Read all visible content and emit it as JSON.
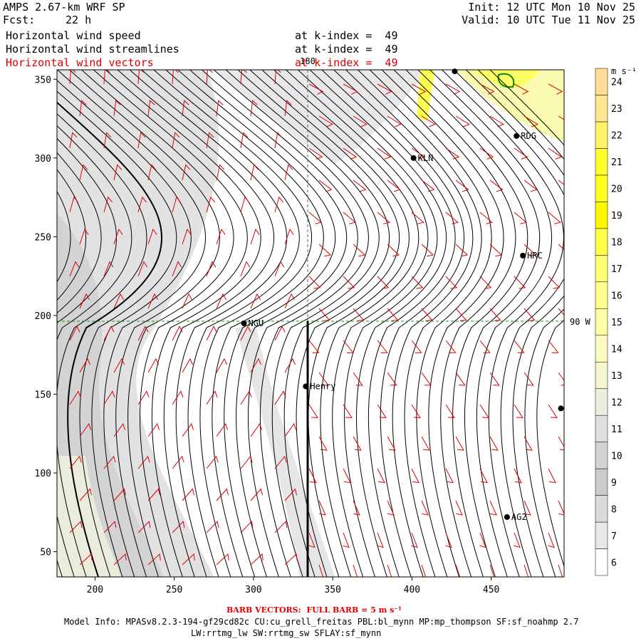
{
  "header": {
    "model": "AMPS 2.67-km WRF SP",
    "init": "Init: 12 UTC Mon 10 Nov 25",
    "fcst_label": "Fcst:",
    "fcst_value": "22 h",
    "valid": "Valid: 10 UTC Tue 11 Nov 25",
    "fields": [
      {
        "name": "Horizontal wind speed",
        "level": "at k-index =  49",
        "color": "#000000"
      },
      {
        "name": "Horizontal wind streamlines",
        "level": "at k-index =  49",
        "color": "#000000"
      },
      {
        "name": "Horizontal wind vectors",
        "level": "at k-index =  49",
        "color": "#dd0000"
      }
    ]
  },
  "chart_data": {
    "type": "heatmap",
    "title": "Horizontal wind speed / streamlines / vectors at k-index = 49",
    "x_ticks": [
      200,
      250,
      300,
      350,
      400,
      450
    ],
    "y_ticks": [
      50,
      100,
      150,
      200,
      250,
      300,
      350
    ],
    "xlim": [
      176,
      496
    ],
    "ylim": [
      34,
      356
    ],
    "grid_labels": {
      "meridian_180": "180",
      "meridian_90w": "90 W"
    },
    "stations": [
      {
        "name": "RDG",
        "x": 466,
        "y": 314
      },
      {
        "name": "KLN",
        "x": 401,
        "y": 300
      },
      {
        "name": "HRC",
        "x": 470,
        "y": 238
      },
      {
        "name": "NGU",
        "x": 294,
        "y": 195
      },
      {
        "name": "Henry",
        "x": 333,
        "y": 155
      },
      {
        "name": "AG2",
        "x": 460,
        "y": 72
      },
      {
        "name": "",
        "x": 427,
        "y": 355
      },
      {
        "name": "",
        "x": 494,
        "y": 141
      }
    ],
    "colorbar": {
      "unit": "m s⁻¹",
      "levels": [
        6,
        7,
        8,
        9,
        10,
        11,
        12,
        13,
        14,
        15,
        16,
        17,
        18,
        19,
        20,
        21,
        22,
        23,
        24
      ],
      "colors": [
        "#ffffff",
        "#e9e9e9",
        "#dadada",
        "#cbcbcb",
        "#d2d2d2",
        "#dfdfdf",
        "#ededde",
        "#f5f5cf",
        "#fafac0",
        "#fdfda6",
        "#ffff8c",
        "#ffff73",
        "#ffff47",
        "#fff700",
        "#ffff20",
        "#ffff30",
        "#fff26b",
        "#ffe690",
        "#ffdc98"
      ]
    },
    "grid": false
  },
  "footer": {
    "barb": "BARB VECTORS:  FULL BARB = 5 m s⁻¹",
    "model_info": "Model Info: MPASv8.2.3-194-gf29cd82c CU:cu_grell_freitas PBL:bl_mynn MP:mp_thompson SF:sf_noahmp 2.7",
    "physics": "LW:rrtmg_lw SW:rrtmg_sw SFLAY:sf_mynn"
  }
}
